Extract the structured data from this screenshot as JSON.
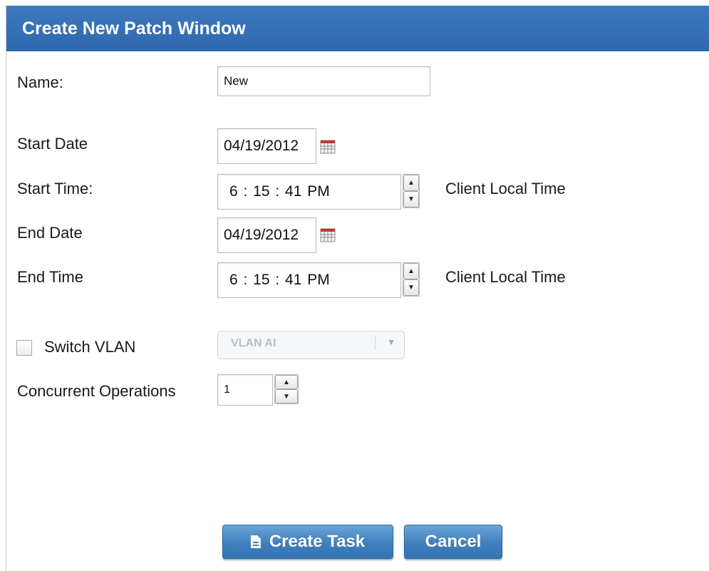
{
  "dialog": {
    "title": "Create New Patch Window"
  },
  "form": {
    "name_label": "Name:",
    "name_value": "New",
    "start_date_label": "Start Date",
    "start_date_value": "04/19/2012",
    "start_time_label": "Start Time:",
    "start_time_value": "6 : 15 : 41 PM",
    "start_time_suffix": "Client Local Time",
    "end_date_label": "End Date",
    "end_date_value": "04/19/2012",
    "end_time_label": "End Time",
    "end_time_value": "6 : 15 : 41 PM",
    "end_time_suffix": "Client Local Time",
    "switch_vlan_label": "Switch VLAN",
    "vlan_value": "VLAN AI",
    "concurrent_label": "Concurrent Operations",
    "concurrent_value": "1"
  },
  "buttons": {
    "create_label": "Create Task",
    "cancel_label": "Cancel"
  },
  "icons": {
    "calendar": "calendar-icon",
    "spinner_up": "▲",
    "spinner_down": "▼",
    "dropdown": "▼",
    "document": "document-icon"
  },
  "colors": {
    "titlebar": "#2f68ad",
    "button": "#3f7fbd"
  }
}
